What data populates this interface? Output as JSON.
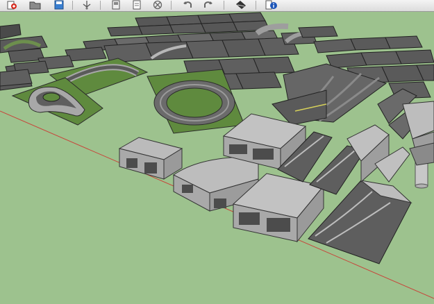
{
  "app": {
    "toolbar_icons": [
      "new-model-icon",
      "open-file-icon",
      "save-icon",
      "select-tool-icon",
      "paste-icon",
      "copy-icon",
      "erase-icon",
      "undo-icon",
      "redo-icon",
      "paint-bucket-icon",
      "model-info-icon"
    ]
  },
  "scene": {
    "description_objects": [
      "road-tile-grid",
      "roundabout-tile",
      "teardrop-loop-tile",
      "ramp-pieces",
      "tunnel-blocks",
      "curved-tunnel-block",
      "cylinder-pillar",
      "red-axis-line"
    ],
    "colors": {
      "ground": "#9dc28e",
      "grass": "#5f8a3e",
      "asphalt": "#5c5c5c",
      "concrete": "#b9b9b9",
      "axis": "#c8443a"
    }
  }
}
